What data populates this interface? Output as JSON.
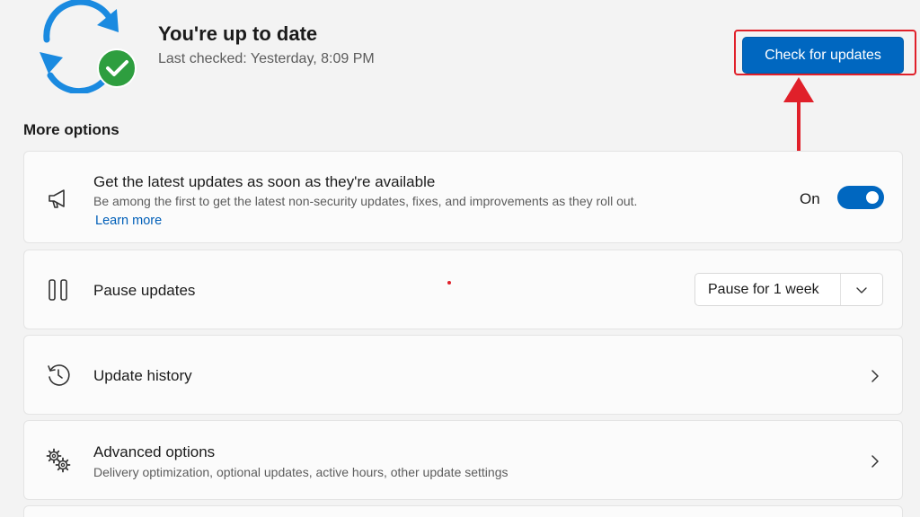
{
  "header": {
    "status_title": "You're up to date",
    "last_checked": "Last checked: Yesterday, 8:09 PM",
    "check_button_label": "Check for updates",
    "status_icon": "sync-check-icon"
  },
  "more_options": {
    "section_title": "More options",
    "cards": [
      {
        "title": "Get the latest updates as soon as they're available",
        "description": "Be among the first to get the latest non-security updates, fixes, and improvements as they roll out.",
        "link": "Learn more",
        "toggle_label": "On",
        "toggle_state": true,
        "icon": "megaphone-icon"
      },
      {
        "title": "Pause updates",
        "dropdown_value": "Pause for 1 week",
        "icon": "pause-icon"
      },
      {
        "title": "Update history",
        "icon": "history-icon"
      },
      {
        "title": "Advanced options",
        "description": "Delivery optimization, optional updates, active hours, other update settings",
        "icon": "gears-icon"
      }
    ]
  },
  "colors": {
    "accent": "#0067c0",
    "annotation": "#e0202a",
    "success": "#2e9e3f"
  }
}
